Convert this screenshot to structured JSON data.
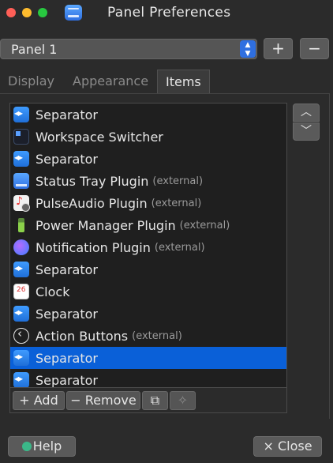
{
  "window": {
    "title": "Panel Preferences"
  },
  "panel_select": {
    "value": "Panel 1"
  },
  "panel_buttons": {
    "add": "+",
    "remove": "−"
  },
  "tabs": [
    {
      "label": "Display"
    },
    {
      "label": "Appearance"
    },
    {
      "label": "Items"
    }
  ],
  "items": [
    {
      "label": "Separator",
      "ext": "",
      "icon": "separator-icon"
    },
    {
      "label": "Workspace Switcher",
      "ext": "",
      "icon": "workspace-switcher-icon"
    },
    {
      "label": "Separator",
      "ext": "",
      "icon": "separator-icon"
    },
    {
      "label": "Status Tray Plugin",
      "ext": "(external)",
      "icon": "status-tray-icon"
    },
    {
      "label": "PulseAudio Plugin",
      "ext": "(external)",
      "icon": "pulseaudio-icon"
    },
    {
      "label": "Power Manager Plugin",
      "ext": "(external)",
      "icon": "battery-icon"
    },
    {
      "label": "Notification Plugin",
      "ext": "(external)",
      "icon": "notification-icon"
    },
    {
      "label": "Separator",
      "ext": "",
      "icon": "separator-icon"
    },
    {
      "label": "Clock",
      "ext": "",
      "icon": "calendar-clock-icon"
    },
    {
      "label": "Separator",
      "ext": "",
      "icon": "separator-icon"
    },
    {
      "label": "Action Buttons",
      "ext": "(external)",
      "icon": "action-buttons-icon"
    },
    {
      "label": "Separator",
      "ext": "",
      "icon": "separator-icon",
      "selected": true
    },
    {
      "label": "Separator",
      "ext": "",
      "icon": "separator-icon"
    }
  ],
  "item_actions": {
    "add": "+ Add",
    "remove": "− Remove"
  },
  "footer": {
    "help": "Help",
    "close": "× Close"
  },
  "colors": {
    "selection": "#0a60d8",
    "accent": "#2f6fe0",
    "background": "#2b2b2b"
  }
}
